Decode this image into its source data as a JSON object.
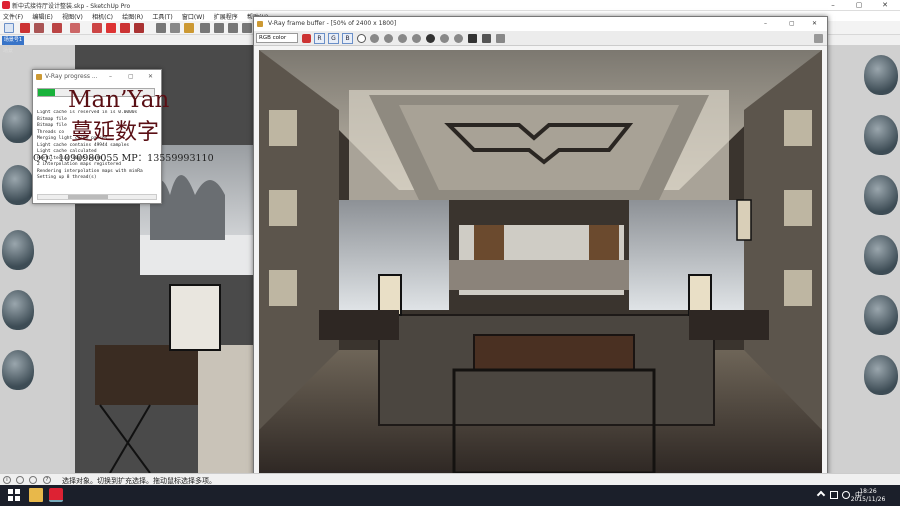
{
  "sketchup": {
    "title": "新中式接待厅设计整装.skp - SketchUp Pro",
    "menu": [
      "文件(F)",
      "编辑(E)",
      "视图(V)",
      "相机(C)",
      "绘图(R)",
      "工具(T)",
      "窗口(W)",
      "扩展程序",
      "帮助(H)"
    ],
    "scene_tab": "场景号1",
    "scene_label": "场景",
    "status_text": "选择对象。切换到扩充选择。拖动鼠标选择多项。",
    "window_controls": [
      "–",
      "▢",
      "✕"
    ]
  },
  "vray_progress": {
    "title": "V-Ray progress ...",
    "progress": 0.15,
    "log": [
      "Light cache is reserved in is 0.0000s",
      "Bitmap file",
      "Bitmap file",
      "Threads co",
      "Merging light cache passes",
      "Light cache contains 49944 samples",
      "Light cache calculated",
      "Prefiltering light cache",
      "2 interpolation maps registered",
      "Rendering interpolation maps with minRa",
      "Setting up 8 thread(s)"
    ],
    "window_controls": [
      "–",
      "▢",
      "✕"
    ]
  },
  "watermark": {
    "name": "Man’Yan",
    "cn": "蔓延数字",
    "contact": "QQ：1090980055   MP：13559993110"
  },
  "frame_buffer": {
    "title": "V-Ray frame buffer - [50% of 2400 x 1800]",
    "channel": "RGB color",
    "channels": [
      "R",
      "G",
      "B"
    ],
    "window_controls": [
      "–",
      "▢",
      "✕"
    ]
  },
  "taskbar": {
    "time": "18:26",
    "date": "2015/11/26",
    "ime": "中"
  },
  "colors": {
    "accent": "#3874c8",
    "progress": "#19b23b",
    "watermark": "#5a0f14"
  }
}
